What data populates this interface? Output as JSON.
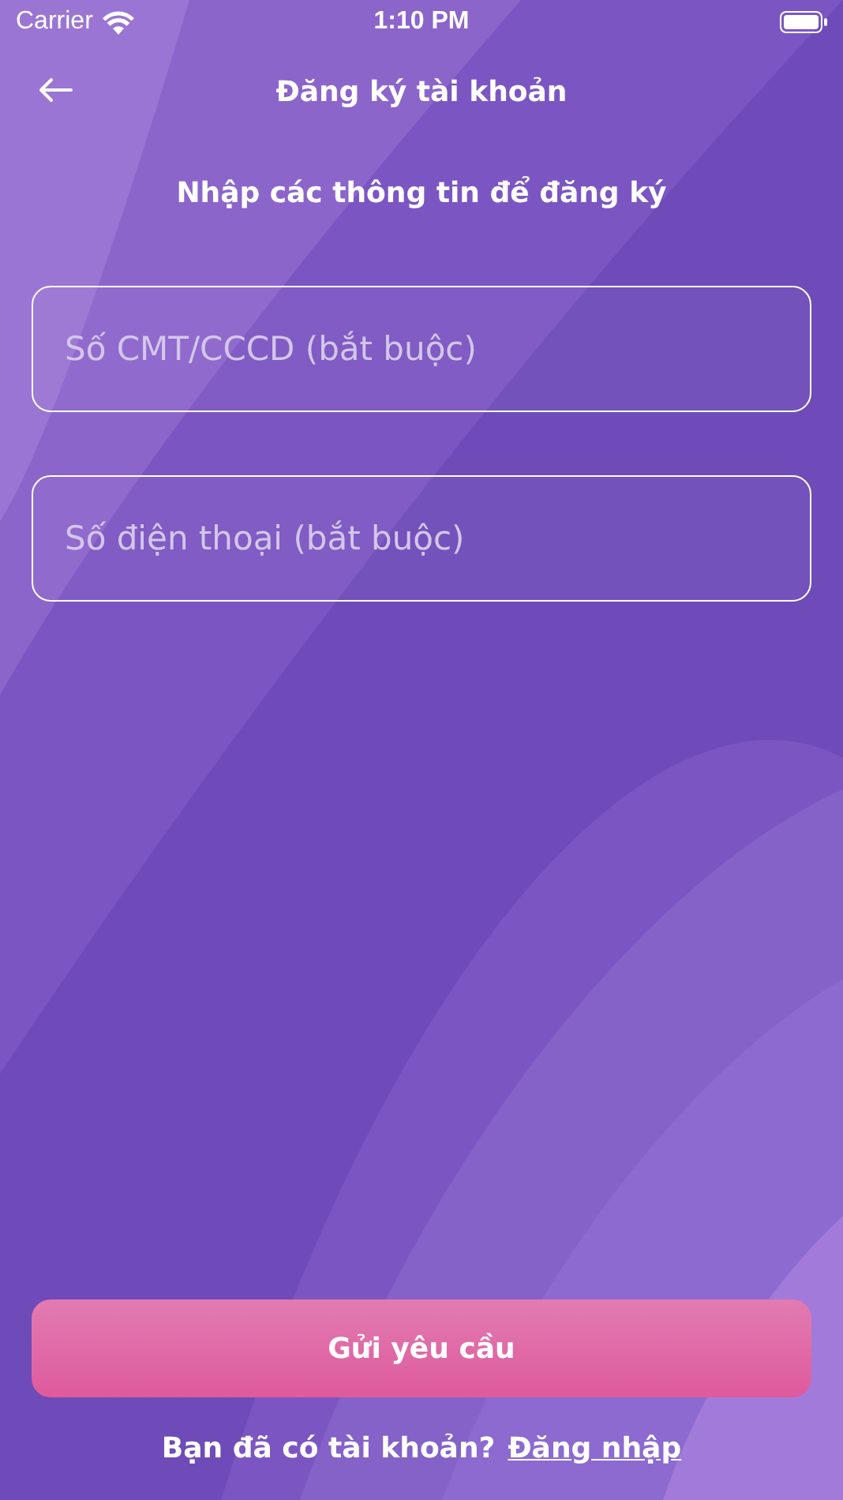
{
  "status_bar": {
    "carrier": "Carrier",
    "time": "1:10 PM"
  },
  "header": {
    "title": "Đăng ký tài khoản"
  },
  "subtitle": "Nhập các thông tin để đăng ký",
  "fields": [
    {
      "placeholder": "Số CMT/CCCD (bắt buộc)"
    },
    {
      "placeholder": "Số điện thoại (bắt buộc)"
    }
  ],
  "submit_button": "Gửi yêu cầu",
  "footer": {
    "question": "Bạn đã có tài khoản?",
    "link": "Đăng nhập"
  }
}
